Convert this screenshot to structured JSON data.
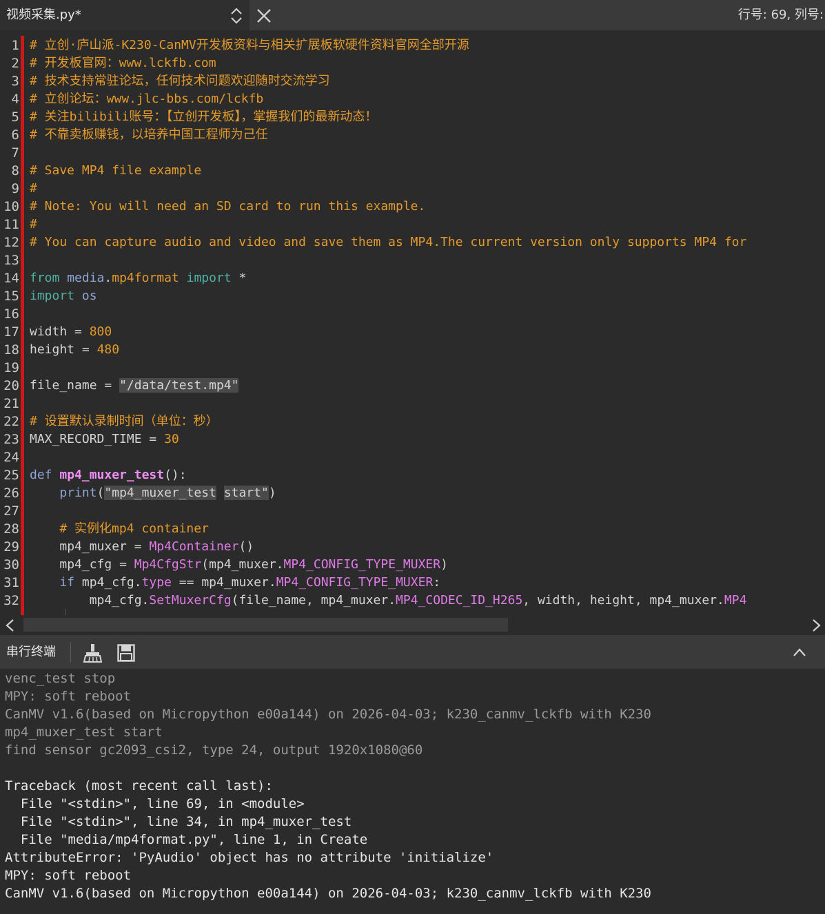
{
  "tab": {
    "filename": "视频采集.py*"
  },
  "status": {
    "cursor_position": "行号: 69, 列号:"
  },
  "terminal": {
    "title": "串行终端",
    "lines": [
      "venc_test stop",
      "MPY: soft reboot",
      "CanMV v1.6(based on Micropython e00a144) on 2026-04-03; k230_canmv_lckfb with K230",
      "mp4_muxer_test start",
      "find sensor gc2093_csi2, type 24, output 1920x1080@60",
      "",
      "Traceback (most recent call last):",
      "  File \"<stdin>\", line 69, in <module>",
      "  File \"<stdin>\", line 34, in mp4_muxer_test",
      "  File \"media/mp4format.py\", line 1, in Create",
      "AttributeError: 'PyAudio' object has no attribute 'initialize'",
      "MPY: soft reboot",
      "CanMV v1.6(based on Micropython e00a144) on 2026-04-03; k230_canmv_lckfb with K230"
    ]
  },
  "editor": {
    "line_numbers": [
      "1",
      "2",
      "3",
      "4",
      "5",
      "6",
      "7",
      "8",
      "9",
      "10",
      "11",
      "12",
      "13",
      "14",
      "15",
      "16",
      "17",
      "18",
      "19",
      "20",
      "21",
      "22",
      "23",
      "24",
      "25",
      "26",
      "27",
      "28",
      "29",
      "30",
      "31",
      "32"
    ],
    "comments": {
      "l1": "# 立创·庐山派-K230-CanMV开发板资料与相关扩展板软硬件资料官网全部开源",
      "l2": "# 开发板官网：www.lckfb.com",
      "l3": "# 技术支持常驻论坛，任何技术问题欢迎随时交流学习",
      "l4": "# 立创论坛：www.jlc-bbs.com/lckfb",
      "l5": "# 关注bilibili账号：【立创开发板】，掌握我们的最新动态！",
      "l6": "# 不靠卖板赚钱，以培养中国工程师为己任",
      "l8": "# Save MP4 file example",
      "l9": "#",
      "l10": "# Note: You will need an SD card to run this example.",
      "l11": "#",
      "l12": "# You can capture audio and video and save them as MP4.The current version only supports MP4 for",
      "l22": "# 设置默认录制时间（单位：秒）",
      "l28": "# 实例化mp4 container"
    },
    "tokens": {
      "l14": {
        "kw_from": "from",
        "module": "media",
        "dot": ".",
        "submodule": "mp4format",
        "kw_import": "import",
        "star": "*"
      },
      "l15": {
        "kw_import": "import",
        "module": "os"
      },
      "l17": {
        "name": "width",
        "eq": "=",
        "value": "800"
      },
      "l18": {
        "name": "height",
        "eq": "=",
        "value": "480"
      },
      "l20": {
        "name": "file_name",
        "eq": "=",
        "value": "\"/data/test.mp4\""
      },
      "l23": {
        "name": "MAX_RECORD_TIME",
        "eq": "=",
        "value": "30"
      },
      "l25": {
        "kw_def": "def",
        "func": "mp4_muxer_test",
        "rest": "():"
      },
      "l26": {
        "func": "print",
        "open": "(",
        "str_a": "\"mp4_muxer_test",
        "str_b": "start\"",
        "close": ")"
      },
      "l29": {
        "name": "mp4_muxer",
        "eq": "=",
        "call": "Mp4Container",
        "rest": "()"
      },
      "l30": {
        "name": "mp4_cfg",
        "eq": "=",
        "call": "Mp4CfgStr",
        "open": "(",
        "obj": "mp4_muxer.",
        "attr": "MP4_CONFIG_TYPE_MUXER",
        "close": ")"
      },
      "l31": {
        "kw_if": "if",
        "obj": "mp4_cfg.",
        "attr": "type",
        "op": "==",
        "obj2": "mp4_muxer.",
        "attr2": "MP4_CONFIG_TYPE_MUXER",
        "colon": ":"
      },
      "l32": {
        "obj": "mp4_cfg.",
        "call": "SetMuxerCfg",
        "args1": "(file_name, mp4_muxer.",
        "attr": "MP4_CODEC_ID_H265",
        "args2": ", width, height, mp4_muxer.",
        "attr2": "MP4"
      }
    }
  }
}
